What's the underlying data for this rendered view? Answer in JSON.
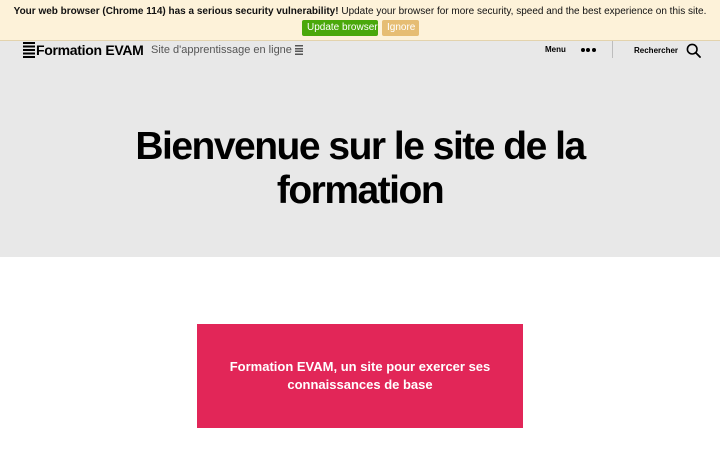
{
  "banner": {
    "warning_bold": "Your web browser (Chrome 114) has a serious security vulnerability!",
    "warning_rest": " Update your browser for more security, speed and the best experience on this site.",
    "update_label": "Update browser",
    "ignore_label": "Ignore",
    "colors": {
      "background": "#fdf2d9",
      "update": "#4aa80b",
      "ignore": "#e6bd73"
    }
  },
  "header": {
    "site_title": "Formation EVAM",
    "tagline": "Site d'apprentissage en ligne",
    "menu_label": "Menu",
    "menu_icon": "dots-horizontal-icon",
    "search_label": "Rechercher",
    "search_icon": "search-icon"
  },
  "hero": {
    "title": "Bienvenue sur le site de la formation",
    "background": "#e8e8e8"
  },
  "content": {
    "card_text": "Formation EVAM, un site pour exercer ses connaissances de base",
    "card_color": "#e22658"
  }
}
